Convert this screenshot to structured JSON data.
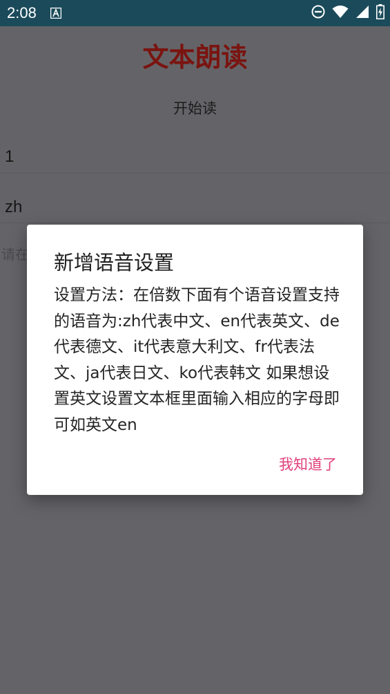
{
  "status_bar": {
    "time": "2:08",
    "notification_icon": "font-a-icon",
    "icons": [
      "do-not-disturb-icon",
      "wifi-icon",
      "cell-signal-icon",
      "battery-icon"
    ],
    "background_color": "#1b4b5b"
  },
  "app": {
    "title": "文本朗读",
    "title_color": "#7a1410",
    "start_button_label": "开始读",
    "fields": [
      {
        "value": "1"
      },
      {
        "value": "zh"
      }
    ],
    "hint_field": {
      "placeholder": "请在"
    }
  },
  "dialog": {
    "title": "新增语音设置",
    "message": "设置方法：在倍数下面有个语音设置支持的语音为:zh代表中文、en代表英文、de代表德文、it代表意大利文、fr代表法文、ja代表日文、ko代表韩文 如果想设置英文设置文本框里面输入相应的字母即可如英文en",
    "confirm_label": "我知道了",
    "accent_color": "#e0407a"
  }
}
